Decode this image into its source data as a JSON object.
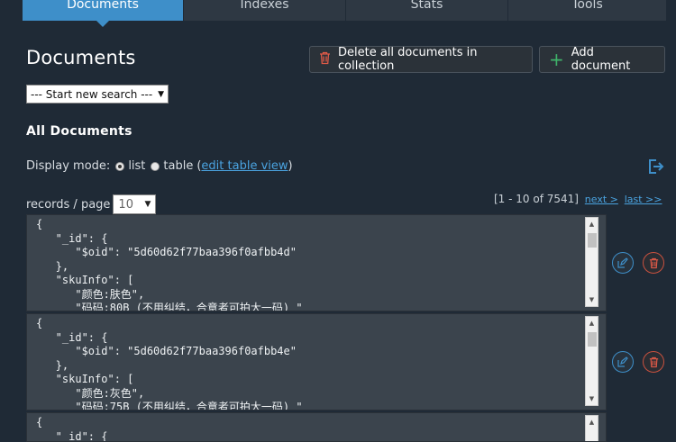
{
  "tabs": [
    {
      "label": "Documents",
      "active": true
    },
    {
      "label": "Indexes",
      "active": false
    },
    {
      "label": "Stats",
      "active": false
    },
    {
      "label": "Tools",
      "active": false
    }
  ],
  "page_title": "Documents",
  "buttons": {
    "delete_all": "Delete all documents in collection",
    "add_document": "Add document"
  },
  "search_select": {
    "value": "--- Start new search ---"
  },
  "section_title": "All Documents",
  "display_mode": {
    "label": "Display mode:",
    "list_label": "list",
    "table_label": "table",
    "open_paren": "(",
    "edit_table_view": "edit table view",
    "close_paren": ")",
    "selected": "list"
  },
  "records_per_page": {
    "label": "records / page",
    "value": "10"
  },
  "pager": {
    "range": "[1 - 10 of 7541]",
    "next": "next >",
    "last": "last >>"
  },
  "documents": [
    {
      "text": "{\n   \"_id\": {\n      \"$oid\": \"5d60d62f77baa396f0afbb4d\"\n   },\n   \"skuInfo\": [\n      \"颜色:肤色\",\n      \"码码:80B (不用纠结，合意者可拍大一码) \""
    },
    {
      "text": "{\n   \"_id\": {\n      \"$oid\": \"5d60d62f77baa396f0afbb4e\"\n   },\n   \"skuInfo\": [\n      \"颜色:灰色\",\n      \"码码:75B (不用纠结，合意者可拍大一码) \""
    },
    {
      "text": "{\n   \"_id\": {"
    }
  ],
  "colors": {
    "accent": "#3e8fc9",
    "danger": "#e05a47",
    "success": "#3fb36a",
    "background": "#1f2a36"
  },
  "icons": {
    "delete": "trash-icon",
    "add": "plus-icon",
    "edit": "edit-icon",
    "export": "export-icon"
  }
}
